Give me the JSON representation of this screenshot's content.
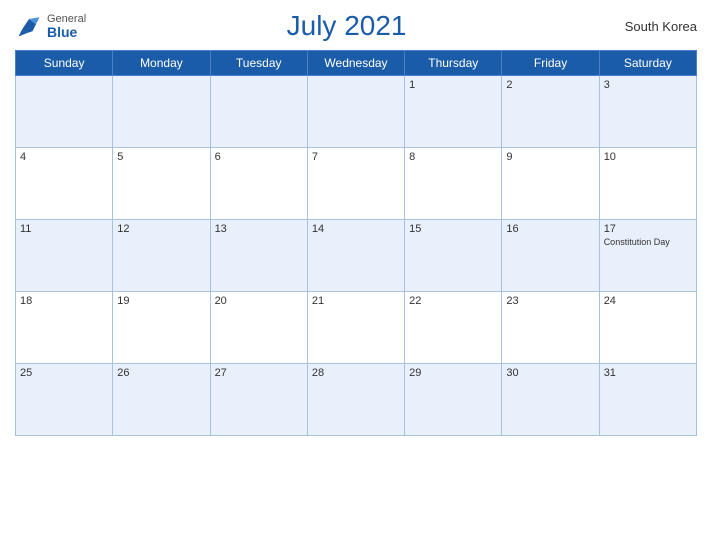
{
  "header": {
    "logo_general": "General",
    "logo_blue": "Blue",
    "month_title": "July 2021",
    "country": "South Korea"
  },
  "days_of_week": [
    "Sunday",
    "Monday",
    "Tuesday",
    "Wednesday",
    "Thursday",
    "Friday",
    "Saturday"
  ],
  "weeks": [
    [
      {
        "date": "",
        "holiday": ""
      },
      {
        "date": "",
        "holiday": ""
      },
      {
        "date": "",
        "holiday": ""
      },
      {
        "date": "",
        "holiday": ""
      },
      {
        "date": "1",
        "holiday": ""
      },
      {
        "date": "2",
        "holiday": ""
      },
      {
        "date": "3",
        "holiday": ""
      }
    ],
    [
      {
        "date": "4",
        "holiday": ""
      },
      {
        "date": "5",
        "holiday": ""
      },
      {
        "date": "6",
        "holiday": ""
      },
      {
        "date": "7",
        "holiday": ""
      },
      {
        "date": "8",
        "holiday": ""
      },
      {
        "date": "9",
        "holiday": ""
      },
      {
        "date": "10",
        "holiday": ""
      }
    ],
    [
      {
        "date": "11",
        "holiday": ""
      },
      {
        "date": "12",
        "holiday": ""
      },
      {
        "date": "13",
        "holiday": ""
      },
      {
        "date": "14",
        "holiday": ""
      },
      {
        "date": "15",
        "holiday": ""
      },
      {
        "date": "16",
        "holiday": ""
      },
      {
        "date": "17",
        "holiday": "Constitution Day"
      }
    ],
    [
      {
        "date": "18",
        "holiday": ""
      },
      {
        "date": "19",
        "holiday": ""
      },
      {
        "date": "20",
        "holiday": ""
      },
      {
        "date": "21",
        "holiday": ""
      },
      {
        "date": "22",
        "holiday": ""
      },
      {
        "date": "23",
        "holiday": ""
      },
      {
        "date": "24",
        "holiday": ""
      }
    ],
    [
      {
        "date": "25",
        "holiday": ""
      },
      {
        "date": "26",
        "holiday": ""
      },
      {
        "date": "27",
        "holiday": ""
      },
      {
        "date": "28",
        "holiday": ""
      },
      {
        "date": "29",
        "holiday": ""
      },
      {
        "date": "30",
        "holiday": ""
      },
      {
        "date": "31",
        "holiday": ""
      }
    ]
  ]
}
